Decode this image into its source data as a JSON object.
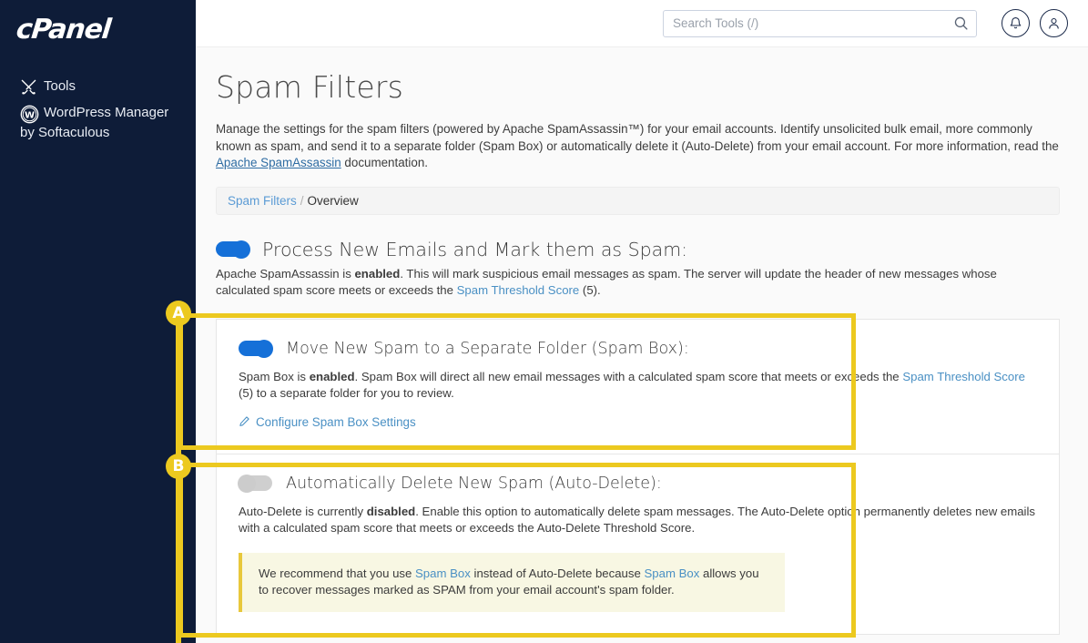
{
  "sidebar": {
    "logo_text": "cPanel",
    "items": [
      {
        "label": "Tools",
        "icon": "tools-icon"
      },
      {
        "label": "WordPress Manager",
        "label2": "by Softaculous",
        "icon": "wordpress-icon"
      }
    ]
  },
  "topbar": {
    "search_placeholder": "Search Tools (/)",
    "search_value": "",
    "search_icon": "search-icon",
    "notifications_icon": "bell-icon",
    "account_icon": "user-icon"
  },
  "page": {
    "title": "Spam Filters",
    "intro_part1": "Manage the settings for the spam filters (powered by Apache SpamAssassin™) for your email accounts. Identify unsolicited bulk email, more commonly known as spam, and send it to a separate folder (Spam Box) or automatically delete it (Auto-Delete) from your email account. For more information, read the ",
    "intro_link": "Apache SpamAssassin",
    "intro_part2": " documentation."
  },
  "breadcrumb": {
    "root": "Spam Filters",
    "separator": "/",
    "current": "Overview"
  },
  "main_section": {
    "toggle_state": "on",
    "title": "Process New Emails and Mark them as Spam:",
    "desc_part1": "Apache SpamAssassin is ",
    "desc_bold": "enabled",
    "desc_part2": ". This will mark suspicious email messages as spam. The server will update the header of new messages whose calculated spam score meets or exceeds the ",
    "desc_link": "Spam Threshold Score",
    "desc_part3": " (5)."
  },
  "spam_box_section": {
    "toggle_state": "on",
    "title": "Move New Spam to a Separate Folder (Spam Box):",
    "desc_part1": "Spam Box is ",
    "desc_bold": "enabled",
    "desc_part2": ". Spam Box will direct all new email messages with a calculated spam score that meets or exceeds the ",
    "desc_link": "Spam Threshold Score",
    "desc_part3": " (5) to a separate folder for you to review.",
    "configure_link": "Configure Spam Box Settings",
    "configure_icon": "pencil-icon"
  },
  "auto_delete_section": {
    "toggle_state": "off",
    "title": "Automatically Delete New Spam (Auto-Delete):",
    "desc_part1": "Auto-Delete is currently ",
    "desc_bold": "disabled",
    "desc_part2": ". Enable this option to automatically delete spam messages. The Auto-Delete option permanently deletes new emails with a calculated spam score that meets or exceeds the Auto-Delete Threshold Score.",
    "notice_part1": "We recommend that you use ",
    "notice_link1": "Spam Box",
    "notice_part2": " instead of Auto-Delete because ",
    "notice_link2": "Spam Box",
    "notice_part3": " allows you to recover messages marked as SPAM from your email account's spam folder."
  },
  "annotations": [
    {
      "label": "A",
      "target": "spam-box-section"
    },
    {
      "label": "B",
      "target": "auto-delete-section"
    }
  ],
  "colors": {
    "sidebar_bg": "#0e1c38",
    "toggle_on": "#1570d8",
    "toggle_off": "#cfcfcf",
    "link": "#4a90c4",
    "annotation": "#ecc91f",
    "notice_bg": "#f8f7e3"
  }
}
